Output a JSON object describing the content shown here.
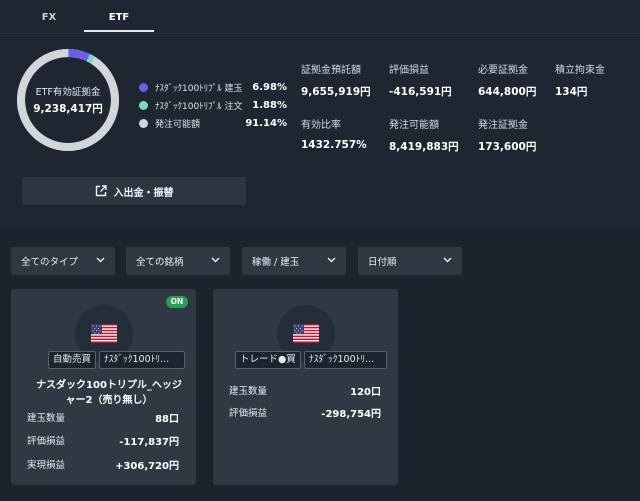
{
  "tabs": [
    {
      "label": "FX",
      "active": false
    },
    {
      "label": "ETF",
      "active": true
    }
  ],
  "summary": {
    "donut": {
      "label": "ETF有効証拠金",
      "value": "9,238,417円",
      "segments": [
        {
          "name": "ﾅｽﾀﾞｯｸ100ﾄﾘﾌﾟﾙ 建玉",
          "percent_label": "6.98%",
          "percent": 6.98,
          "color": "#6c5ce7"
        },
        {
          "name": "ﾅｽﾀﾞｯｸ100ﾄﾘﾌﾟﾙ 注文",
          "percent_label": "1.88%",
          "percent": 1.88,
          "color": "#7fd6c3"
        },
        {
          "name": "発注可能額",
          "percent_label": "91.14%",
          "percent": 91.14,
          "color": "#d3d6d9"
        }
      ]
    },
    "stats": [
      {
        "label": "証拠金預託額",
        "value": "9,655,919円"
      },
      {
        "label": "評価損益",
        "value": "-416,591円"
      },
      {
        "label": "必要証拠金",
        "value": "644,800円"
      },
      {
        "label": "積立拘束金",
        "value": "134円"
      },
      {
        "label": "有効比率",
        "value": "1432.757%"
      },
      {
        "label": "発注可能額",
        "value": "8,419,883円"
      },
      {
        "label": "発注証拠金",
        "value": "173,600円"
      }
    ],
    "deposit_button": {
      "label": "入出金・振替",
      "icon": "external-link-icon"
    }
  },
  "filters": [
    {
      "label": "全てのタイプ",
      "icon": "chevron-down-icon"
    },
    {
      "label": "全ての銘柄",
      "icon": "chevron-down-icon"
    },
    {
      "label": "稼働 / 建玉",
      "icon": "chevron-down-icon"
    },
    {
      "label": "日付順",
      "icon": "chevron-down-icon"
    }
  ],
  "cards": [
    {
      "badge": "ON",
      "flag": "us-flag-icon",
      "tags": [
        "自動売買",
        "ﾅｽﾀﾞｯｸ100ﾄﾘ..."
      ],
      "title_line1": "ナスダック100トリプル_ヘッジ",
      "title_line2": "ャー2（売り無し）",
      "rows": [
        {
          "label": "建玉数量",
          "value": "88口"
        },
        {
          "label": "評価損益",
          "value": "-117,837円"
        },
        {
          "label": "実現損益",
          "value": "+306,720円"
        }
      ]
    },
    {
      "flag": "us-flag-icon",
      "tags": [
        "トレード●買",
        "ﾅｽﾀﾞｯｸ100ﾄﾘ..."
      ],
      "rows": [
        {
          "label": "建玉数量",
          "value": "120口"
        },
        {
          "label": "評価損益",
          "value": "-298,754円"
        }
      ]
    }
  ]
}
